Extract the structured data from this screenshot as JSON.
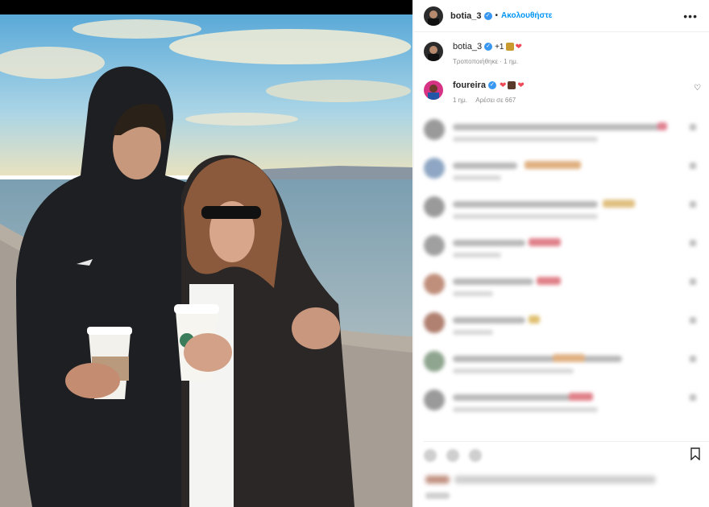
{
  "header": {
    "username": "botia_3",
    "follow_label": "Ακολουθήστε",
    "more_label": "•••"
  },
  "caption": {
    "username": "botia_3",
    "text": "+1",
    "meta": "Τροποποιήθηκε · 1 ημ."
  },
  "pinned_comment": {
    "username": "foureira",
    "time": "1 ημ.",
    "likes": "Αρέσει σε 667"
  },
  "colors": {
    "link": "#0095f6",
    "verified": "#3897f0",
    "heart": "#ed4956"
  },
  "icons": [
    "verified-badge-icon",
    "heart-icon",
    "more-icon",
    "bookmark-icon"
  ]
}
